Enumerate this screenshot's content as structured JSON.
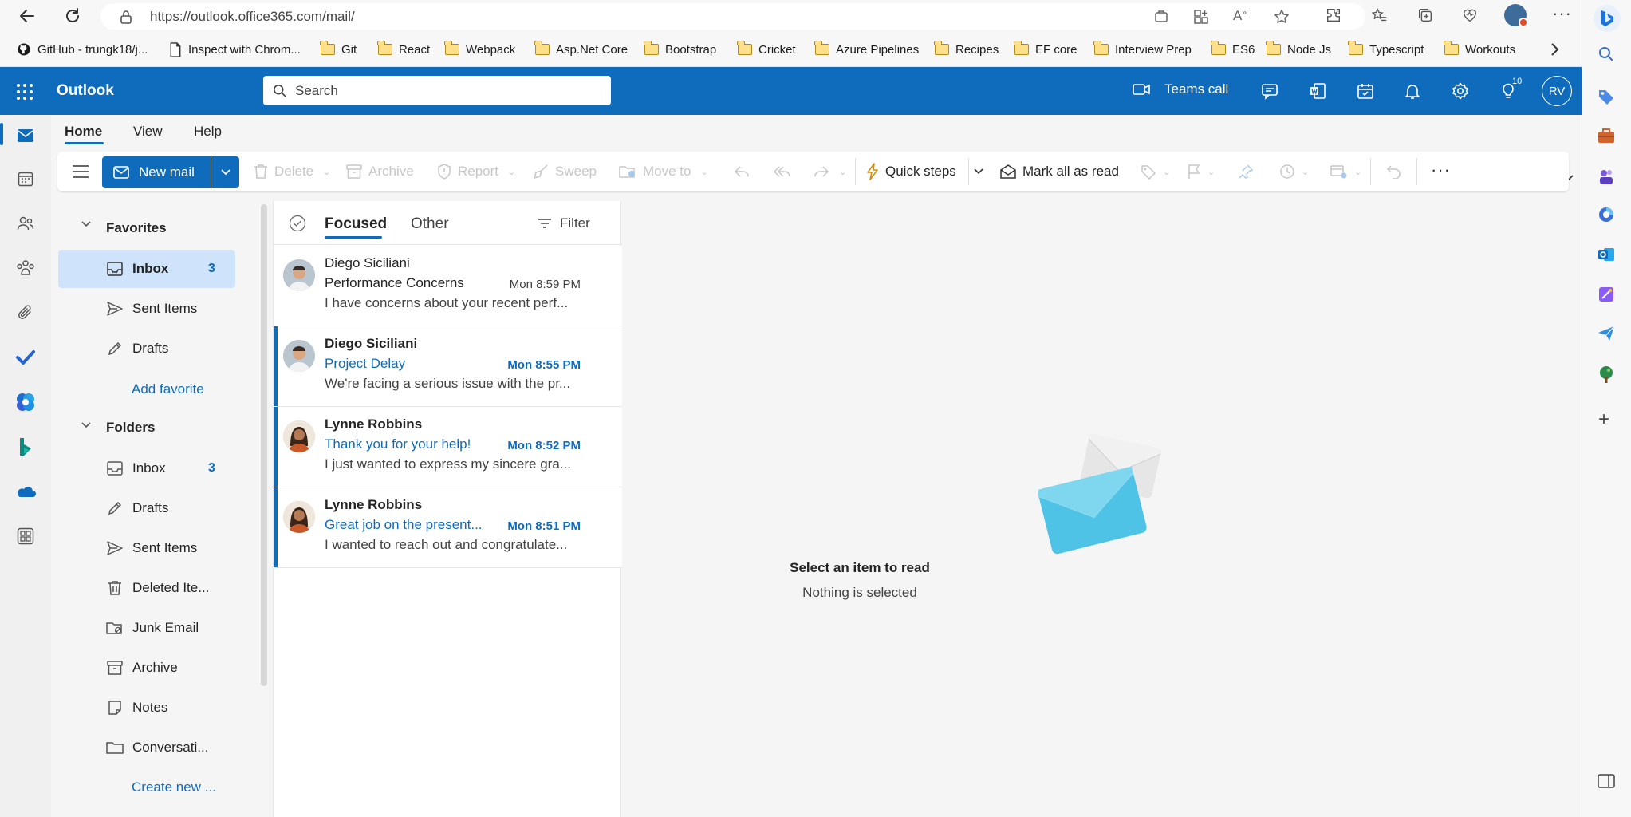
{
  "browser": {
    "url": "https://outlook.office365.com/mail/",
    "bookmarks": [
      {
        "label": "GitHub - trungk18/j...",
        "icon": "github-icon"
      },
      {
        "label": "Inspect with Chrom...",
        "icon": "page-icon"
      },
      {
        "label": "Git",
        "icon": "folder-icon"
      },
      {
        "label": "React",
        "icon": "folder-icon"
      },
      {
        "label": "Webpack",
        "icon": "folder-icon"
      },
      {
        "label": "Asp.Net Core",
        "icon": "folder-icon"
      },
      {
        "label": "Bootstrap",
        "icon": "folder-icon"
      },
      {
        "label": "Cricket",
        "icon": "folder-icon"
      },
      {
        "label": "Azure Pipelines",
        "icon": "folder-icon"
      },
      {
        "label": "Recipes",
        "icon": "folder-icon"
      },
      {
        "label": "EF core",
        "icon": "folder-icon"
      },
      {
        "label": "Interview Prep",
        "icon": "folder-icon"
      },
      {
        "label": "ES6",
        "icon": "folder-icon"
      },
      {
        "label": "Node Js",
        "icon": "folder-icon"
      },
      {
        "label": "Typescript",
        "icon": "folder-icon"
      },
      {
        "label": "Workouts",
        "icon": "folder-icon"
      }
    ]
  },
  "header": {
    "app_name": "Outlook",
    "search_placeholder": "Search",
    "teams_call": "Teams call",
    "tips_badge": "10",
    "avatar_initials": "RV",
    "brand_color": "#0f6cbd"
  },
  "tabs": [
    {
      "label": "Home"
    },
    {
      "label": "View"
    },
    {
      "label": "Help"
    }
  ],
  "ribbon": {
    "new_mail": "New mail",
    "delete": "Delete",
    "archive": "Archive",
    "report": "Report",
    "sweep": "Sweep",
    "move_to": "Move to",
    "quick_steps": "Quick steps",
    "mark_all_read": "Mark all as read"
  },
  "favorites": {
    "title": "Favorites",
    "items": [
      {
        "label": "Inbox",
        "count": "3"
      },
      {
        "label": "Sent Items",
        "count": ""
      },
      {
        "label": "Drafts",
        "count": ""
      }
    ],
    "add_favorite": "Add favorite"
  },
  "folders": {
    "title": "Folders",
    "items": [
      {
        "label": "Inbox",
        "count": "3"
      },
      {
        "label": "Drafts",
        "count": ""
      },
      {
        "label": "Sent Items",
        "count": ""
      },
      {
        "label": "Deleted Ite...",
        "count": ""
      },
      {
        "label": "Junk Email",
        "count": ""
      },
      {
        "label": "Archive",
        "count": ""
      },
      {
        "label": "Notes",
        "count": ""
      },
      {
        "label": "Conversati...",
        "count": ""
      }
    ],
    "create_new": "Create new ..."
  },
  "list": {
    "focused": "Focused",
    "other": "Other",
    "filter": "Filter",
    "messages": [
      {
        "from": "Diego Siciliani",
        "subject": "Performance Concerns",
        "time": "Mon 8:59 PM",
        "preview": "I have concerns about your recent perf...",
        "unread": false
      },
      {
        "from": "Diego Siciliani",
        "subject": "Project Delay",
        "time": "Mon 8:55 PM",
        "preview": "We're facing a serious issue with the pr...",
        "unread": true
      },
      {
        "from": "Lynne Robbins",
        "subject": "Thank you for your help!",
        "time": "Mon 8:52 PM",
        "preview": "I just wanted to express my sincere gra...",
        "unread": true
      },
      {
        "from": "Lynne Robbins",
        "subject": "Great job on the present...",
        "time": "Mon 8:51 PM",
        "preview": "I wanted to reach out and congratulate...",
        "unread": true
      }
    ]
  },
  "reading": {
    "title": "Select an item to read",
    "subtitle": "Nothing is selected"
  }
}
